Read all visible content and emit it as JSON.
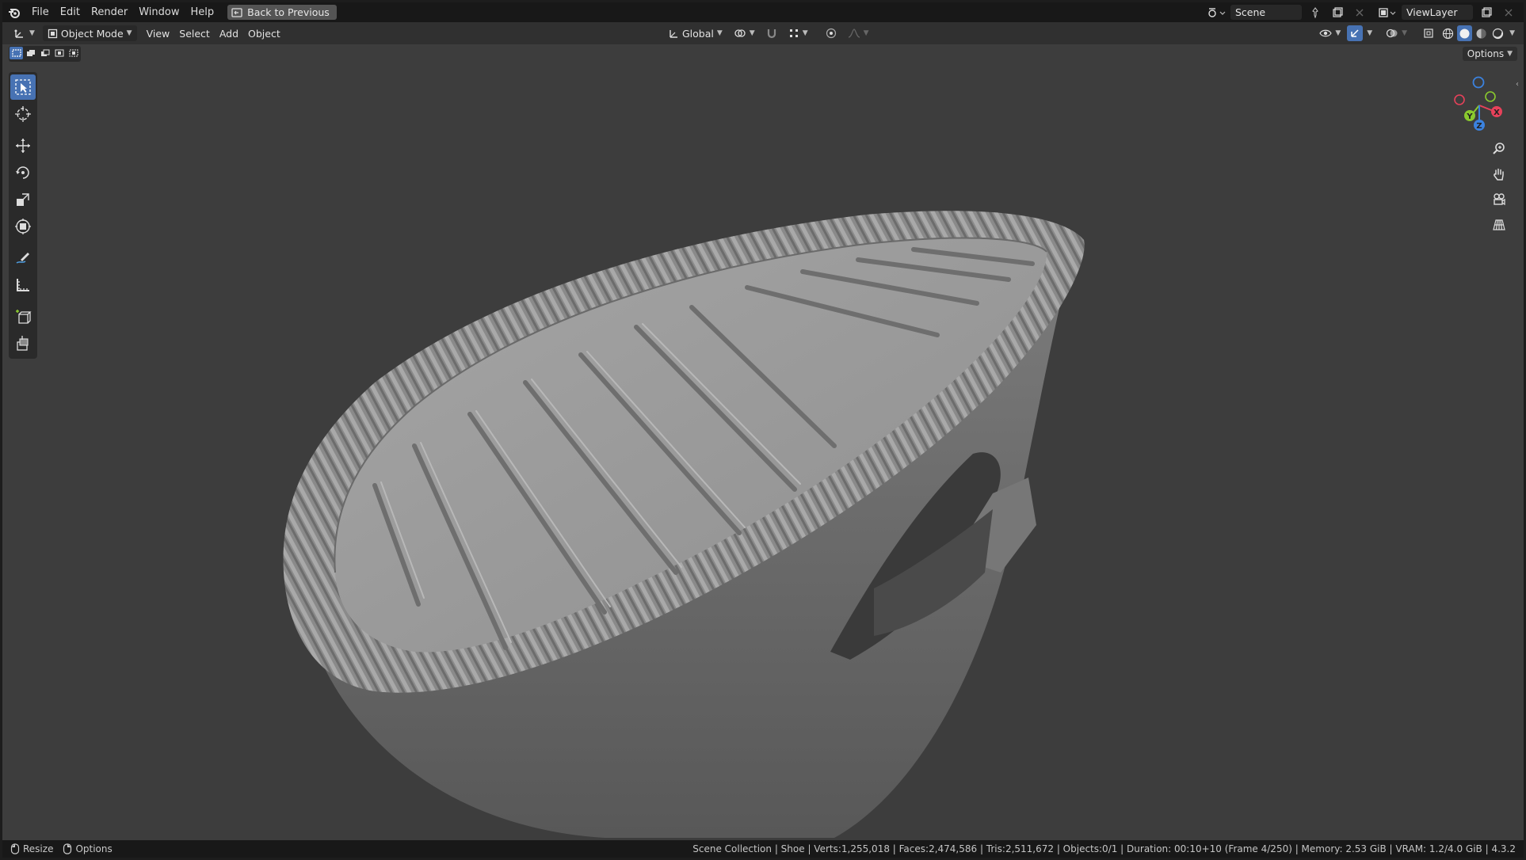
{
  "menu": {
    "items": [
      "File",
      "Edit",
      "Render",
      "Window",
      "Help"
    ],
    "back_button": "Back to Previous"
  },
  "topbar": {
    "scene_name": "Scene",
    "view_layer": "ViewLayer"
  },
  "header": {
    "mode": "Object Mode",
    "menus": [
      "View",
      "Select",
      "Add",
      "Object"
    ],
    "transform_orientation": "Global"
  },
  "tool_settings": {
    "options_label": "Options"
  },
  "toolbar": {
    "tools": [
      "select-box",
      "cursor",
      "move",
      "rotate",
      "scale",
      "transform",
      "annotate",
      "measure",
      "add-cube",
      "extrude"
    ],
    "active_tool": "select-box"
  },
  "gizmo": {
    "axes": [
      "X",
      "Y",
      "Z"
    ],
    "colors": {
      "x": "#e8415a",
      "y": "#8ac92e",
      "z": "#3b82df"
    }
  },
  "statusbar": {
    "resize_label": "Resize",
    "options_label": "Options",
    "info": "Scene Collection | Shoe | Verts:1,255,018 | Faces:2,474,586 | Tris:2,511,672 | Objects:0/1 | Duration: 00:10+10 (Frame 4/250) | Memory: 2.53 GiB | VRAM: 1.2/4.0 GiB | 4.3.2"
  },
  "colors": {
    "accent": "#4772b3",
    "viewport_bg": "#3d3d3d",
    "model_gray": "#8e8e8e"
  }
}
